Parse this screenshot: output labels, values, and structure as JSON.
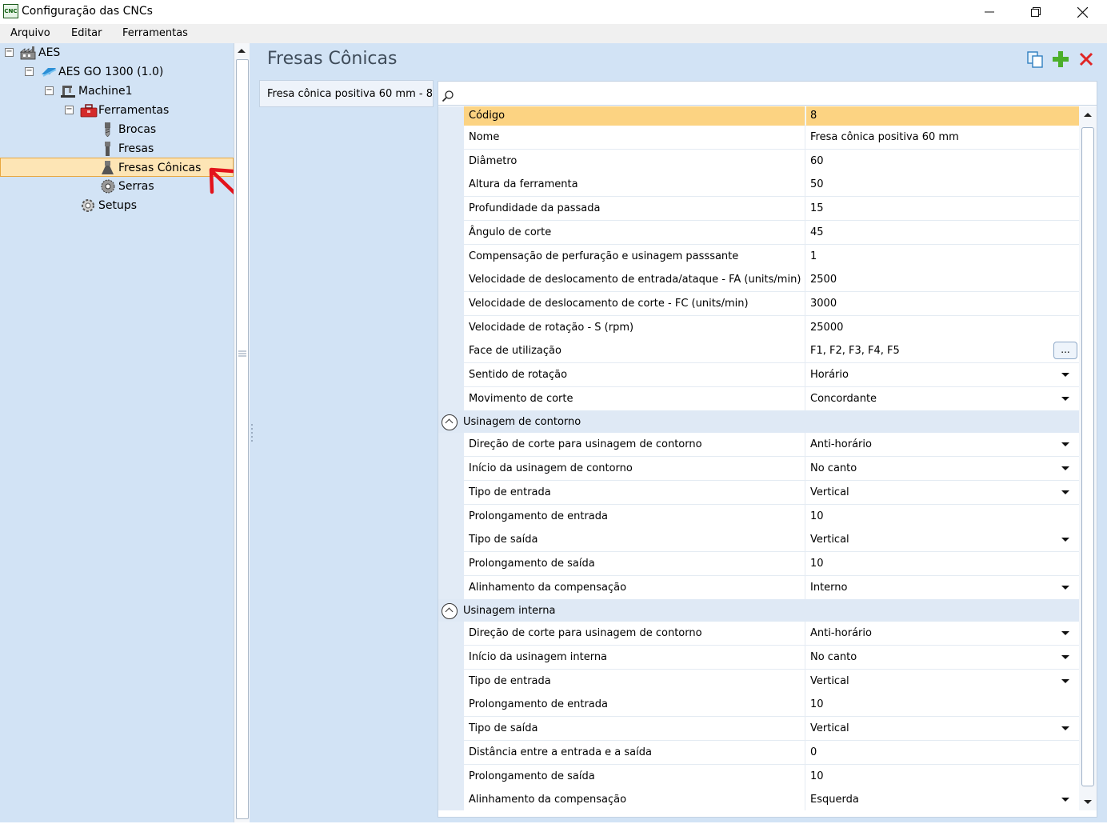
{
  "window": {
    "icon_text": "CNC",
    "title": "Configuração das CNCs"
  },
  "menu": [
    "Arquivo",
    "Editar",
    "Ferramentas"
  ],
  "tree": {
    "root": "AES",
    "machine_group": "AES GO 1300 (1.0)",
    "machine": "Machine1",
    "tools": "Ferramentas",
    "brocas": "Brocas",
    "fresas": "Fresas",
    "fresas_conicas": "Fresas Cônicas",
    "serras": "Serras",
    "setups": "Setups"
  },
  "main": {
    "title": "Fresas Cônicas",
    "selected_item": "Fresa cônica positiva 60 mm - 8"
  },
  "properties": [
    {
      "name": "Código",
      "value": "8",
      "control": "text"
    },
    {
      "name": "Nome",
      "value": "Fresa cônica positiva 60 mm",
      "control": "text"
    },
    {
      "name": "Diâmetro",
      "value": "60",
      "control": "text"
    },
    {
      "name": "Altura da ferramenta",
      "value": "50",
      "control": "text"
    },
    {
      "name": "Profundidade da passada",
      "value": "15",
      "control": "text"
    },
    {
      "name": "Ângulo de corte",
      "value": "45",
      "control": "text"
    },
    {
      "name": "Compensação de perfuração e usinagem passsante",
      "value": "1",
      "control": "text"
    },
    {
      "name": "Velocidade de deslocamento de entrada/ataque - FA (units/min)",
      "value": "2500",
      "control": "text"
    },
    {
      "name": "Velocidade de deslocamento de corte - FC (units/min)",
      "value": "3000",
      "control": "text"
    },
    {
      "name": "Velocidade de rotação - S (rpm)",
      "value": "25000",
      "control": "text"
    },
    {
      "name": "Face de utilização",
      "value": "F1, F2, F3, F4, F5",
      "control": "ellipsis"
    },
    {
      "name": "Sentido de rotação",
      "value": "Horário",
      "control": "dropdown"
    },
    {
      "name": "Movimento de corte",
      "value": "Concordante",
      "control": "dropdown"
    }
  ],
  "ellipsis_label": "...",
  "categories": [
    {
      "name": "Usinagem de contorno",
      "rows": [
        {
          "name": "Direção de corte para usinagem de contorno",
          "value": "Anti-horário",
          "control": "dropdown"
        },
        {
          "name": "Início da usinagem de contorno",
          "value": "No canto",
          "control": "dropdown"
        },
        {
          "name": "Tipo de entrada",
          "value": "Vertical",
          "control": "dropdown"
        },
        {
          "name": "Prolongamento de entrada",
          "value": "10",
          "control": "text"
        },
        {
          "name": "Tipo de saída",
          "value": "Vertical",
          "control": "dropdown"
        },
        {
          "name": "Prolongamento de saída",
          "value": "10",
          "control": "text"
        },
        {
          "name": "Alinhamento da compensação",
          "value": "Interno",
          "control": "dropdown"
        }
      ]
    },
    {
      "name": "Usinagem interna",
      "rows": [
        {
          "name": "Direção de corte para usinagem de contorno",
          "value": "Anti-horário",
          "control": "dropdown"
        },
        {
          "name": "Início da usinagem interna",
          "value": "No canto",
          "control": "dropdown"
        },
        {
          "name": "Tipo de entrada",
          "value": "Vertical",
          "control": "dropdown"
        },
        {
          "name": "Prolongamento de entrada",
          "value": "10",
          "control": "text"
        },
        {
          "name": "Tipo de saída",
          "value": "Vertical",
          "control": "dropdown"
        },
        {
          "name": "Distância entre a entrada e a saída",
          "value": "0",
          "control": "text"
        },
        {
          "name": "Prolongamento de saída",
          "value": "10",
          "control": "text"
        },
        {
          "name": "Alinhamento da compensação",
          "value": "Esquerda",
          "control": "dropdown"
        }
      ]
    }
  ],
  "colors": {
    "pane_bg": "#d2e3f5",
    "selection": "#fde5b5",
    "active_row": "#fcd382",
    "annotation_arrow": "#e3131b",
    "add_icon": "#4caf2a",
    "delete_icon": "#e02525"
  }
}
